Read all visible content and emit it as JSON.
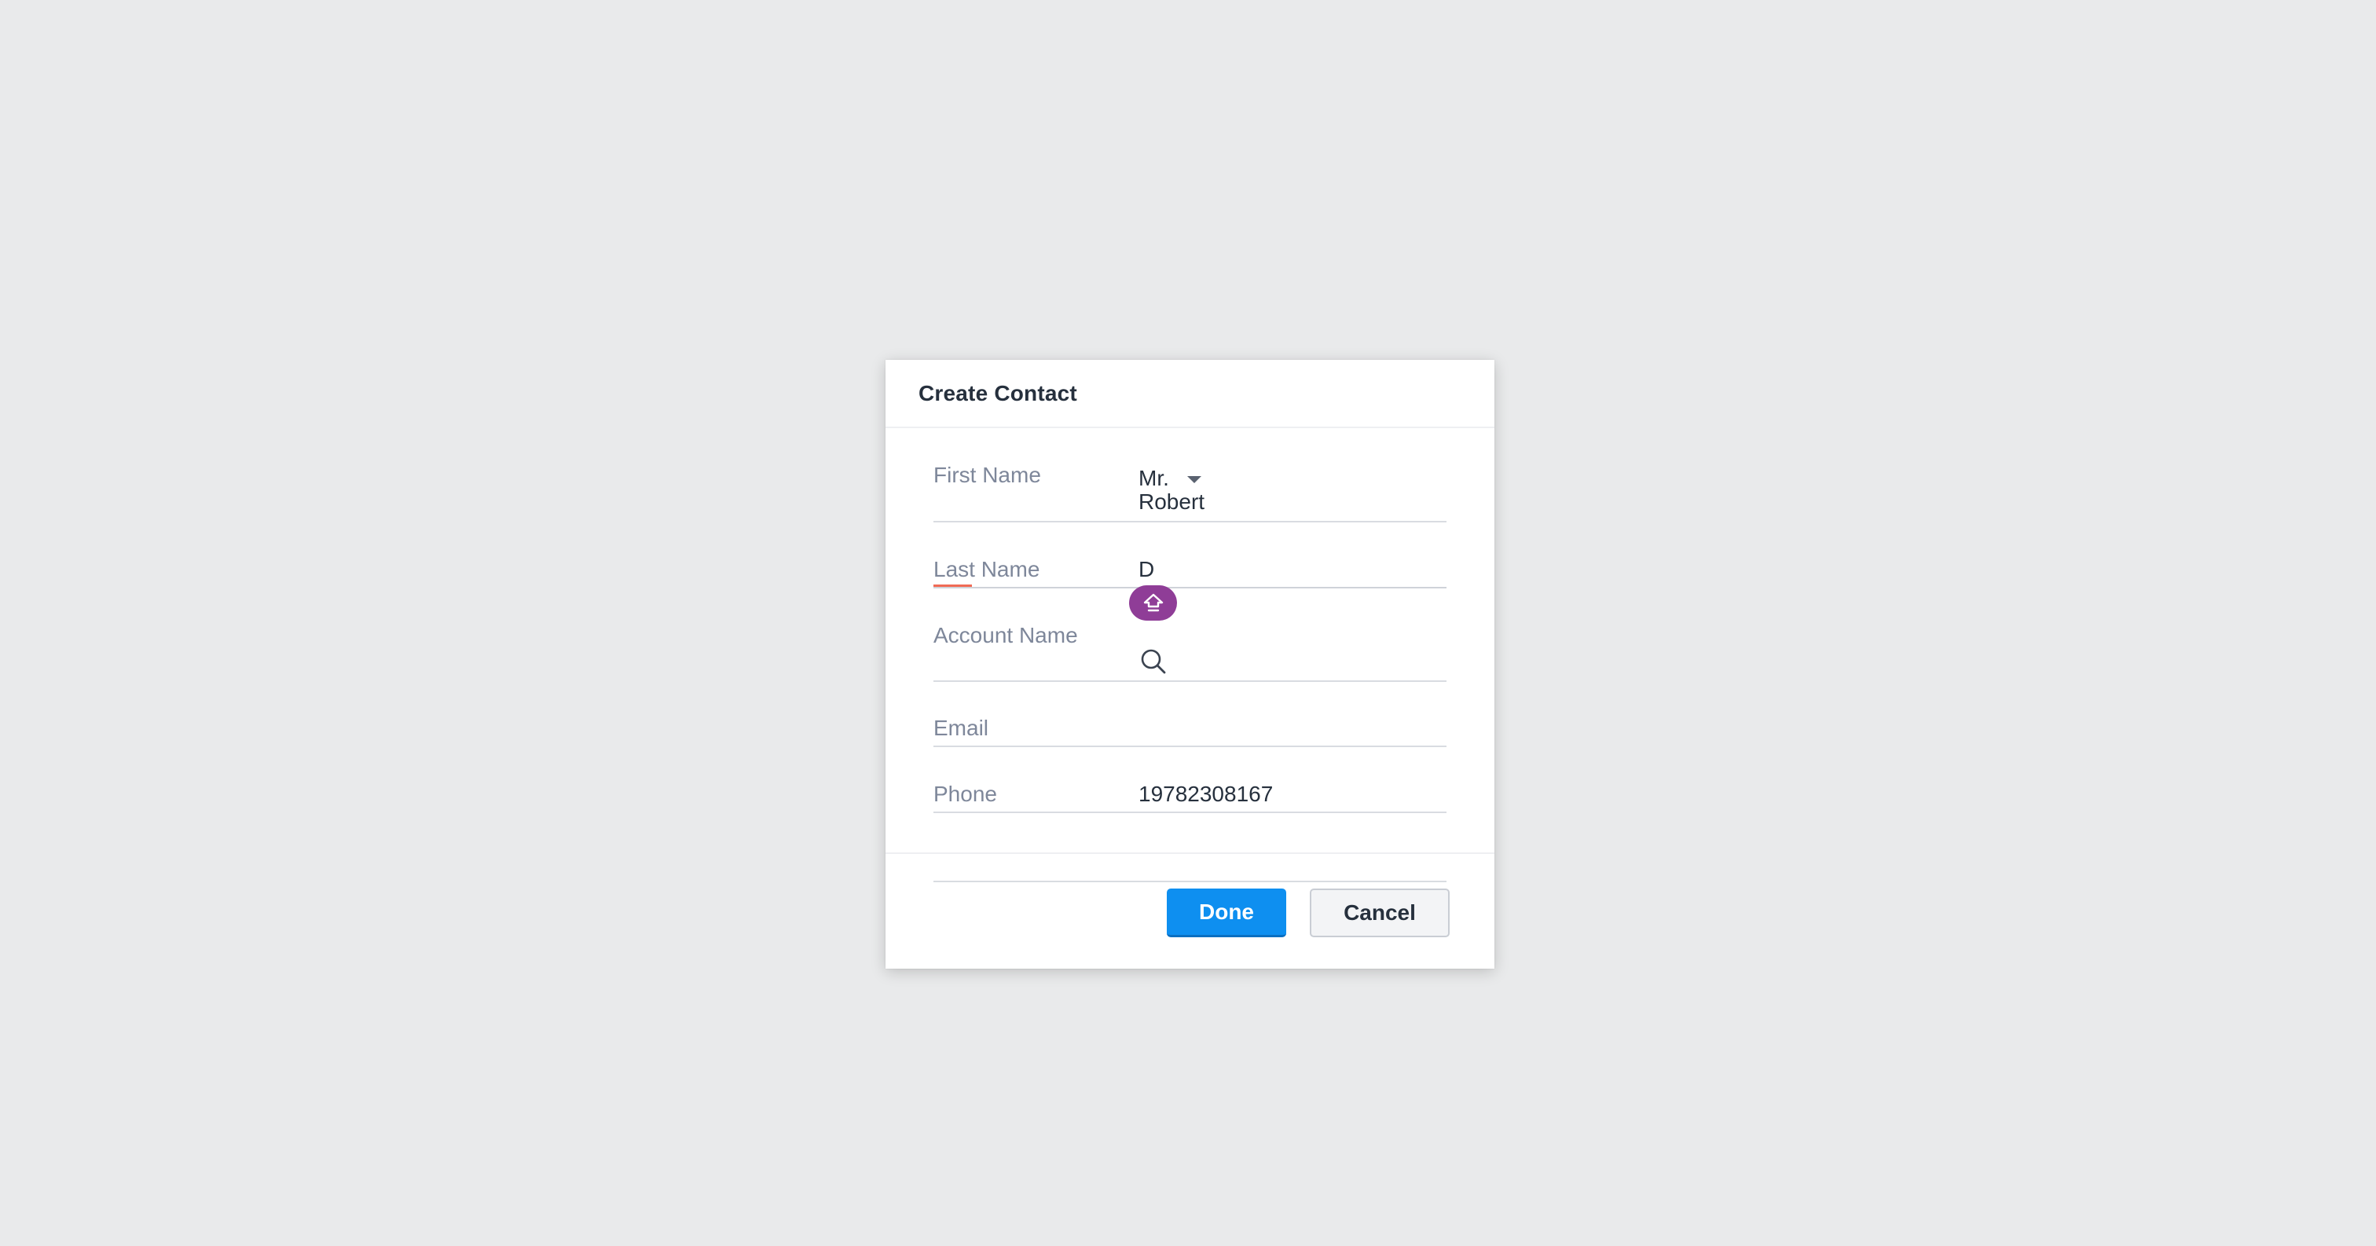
{
  "dialog": {
    "title": "Create Contact"
  },
  "fields": {
    "first_name": {
      "label": "First Name",
      "salutation": "Mr.",
      "value": "Robert"
    },
    "last_name": {
      "label": "Last Name",
      "value": "D"
    },
    "account_name": {
      "label": "Account Name",
      "value": ""
    },
    "email": {
      "label": "Email",
      "value": ""
    },
    "phone": {
      "label": "Phone",
      "value": "19782308167"
    }
  },
  "footer": {
    "done_label": "Done",
    "cancel_label": "Cancel"
  },
  "icons": {
    "salutation_dropdown": "caret-down-icon",
    "account_lookup": "search-icon",
    "helper_badge": "home-arrow-icon"
  },
  "colors": {
    "primary": "#0e8ff0",
    "accent_purple": "#8f3d97",
    "required": "#f06a55"
  }
}
